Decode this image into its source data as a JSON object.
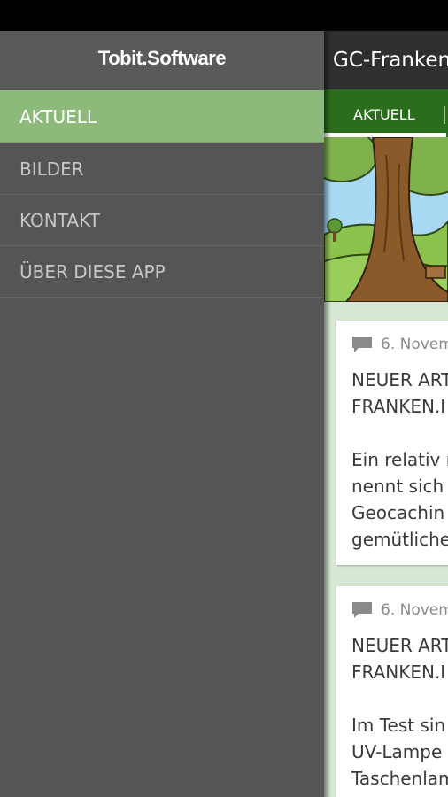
{
  "app": {
    "title": "GC-Franken",
    "tabs": [
      {
        "label": "AKTUELL"
      }
    ],
    "accent_color": "#2a6e1d"
  },
  "drawer": {
    "logo": "Tobit.Software",
    "items": [
      {
        "label": "AKTUELL",
        "active": true
      },
      {
        "label": "BILDER",
        "active": false
      },
      {
        "label": "KONTAKT",
        "active": false
      },
      {
        "label": "ÜBER DIESE APP",
        "active": false
      }
    ],
    "active_color": "#8dba7b"
  },
  "feed": {
    "posts": [
      {
        "icon": "comment-icon",
        "date": "6. Novem",
        "title": "NEUER ART\nFRANKEN.I",
        "body": "Ein relativ n\nnennt sich\nGeocachin\ngemütliche"
      },
      {
        "icon": "comment-icon",
        "date": "6. Novem",
        "title": "NEUER ART\nFRANKEN.I",
        "body": "Im Test sin\nUV-Lampe\nTaschenlam"
      }
    ]
  }
}
